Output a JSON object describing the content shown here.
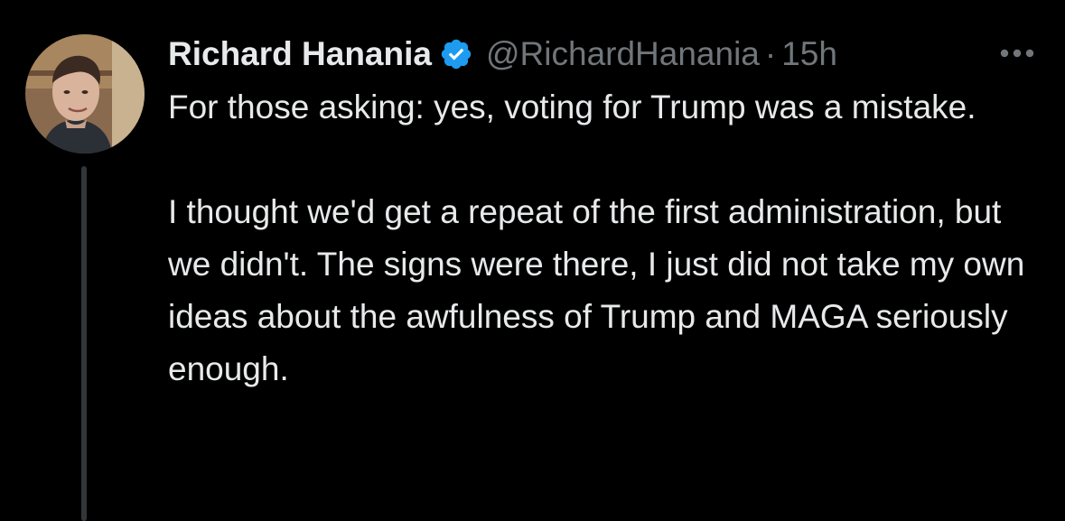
{
  "tweet": {
    "author": {
      "display_name": "Richard Hanania",
      "handle": "@RichardHanania",
      "verified_icon": "verified-badge-icon",
      "avatar": "avatar-photo"
    },
    "separator": "·",
    "time": "15h",
    "more_icon": "more-options-icon",
    "paragraphs": [
      "For those asking: yes, voting for Trump was a mistake.",
      "I thought we'd get a repeat of the first administration, but we didn't. The signs were there, I just did not take my own ideas about the awfulness of Trump and MAGA seriously enough."
    ]
  },
  "colors": {
    "background": "#000000",
    "primary_text": "#e7e9ea",
    "secondary_text": "#71767b",
    "verified_blue": "#1d9bf0",
    "thread_line": "#333639"
  }
}
